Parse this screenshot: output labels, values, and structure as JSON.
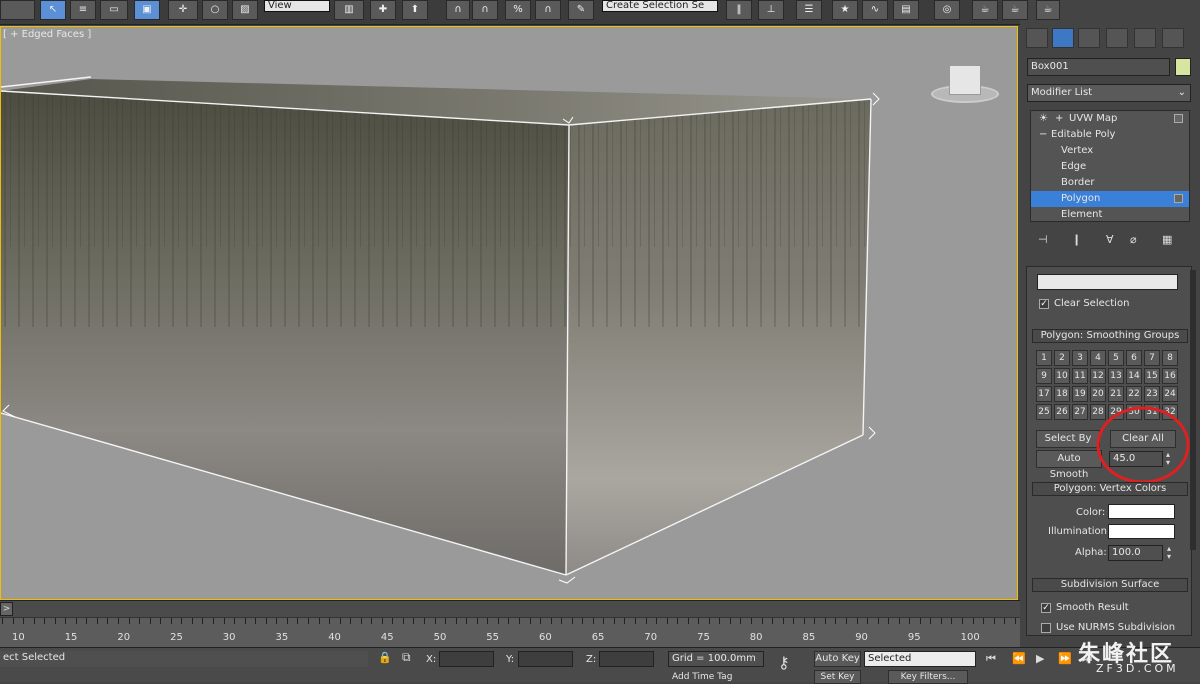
{
  "toolbar": {
    "view_dropdown": "View",
    "selection_set_dropdown": "Create Selection Se"
  },
  "viewport": {
    "label": "[ + Edged Faces ]"
  },
  "command_panel": {
    "object_name": "Box001",
    "modifier_list": "Modifier List",
    "stack": [
      {
        "label": "UVW Map"
      },
      {
        "label": "Editable Poly"
      },
      {
        "label": "Vertex"
      },
      {
        "label": "Edge"
      },
      {
        "label": "Border"
      },
      {
        "label": "Polygon"
      },
      {
        "label": "Element"
      }
    ],
    "clear_selection": "Clear Selection",
    "smoothing_groups": {
      "title": "Polygon: Smoothing Groups",
      "numbers": [
        "1",
        "2",
        "3",
        "4",
        "5",
        "6",
        "7",
        "8",
        "9",
        "10",
        "11",
        "12",
        "13",
        "14",
        "15",
        "16",
        "17",
        "18",
        "19",
        "20",
        "21",
        "22",
        "23",
        "24",
        "25",
        "26",
        "27",
        "28",
        "29",
        "30",
        "31",
        "32"
      ],
      "select_by_sg": "Select By SG",
      "clear_all": "Clear All",
      "auto_smooth": "Auto Smooth",
      "auto_smooth_value": "45.0"
    },
    "vertex_colors": {
      "title": "Polygon: Vertex Colors",
      "color_label": "Color:",
      "illumination_label": "Illumination:",
      "alpha_label": "Alpha:",
      "alpha_value": "100.0"
    },
    "subdivision": {
      "title": "Subdivision Surface",
      "smooth_result": "Smooth Result",
      "use_nurms": "Use NURMS Subdivision"
    }
  },
  "timeline": {
    "slider_button": ">",
    "ticks": [
      "10",
      "15",
      "20",
      "25",
      "30",
      "35",
      "40",
      "45",
      "50",
      "55",
      "60",
      "65",
      "70",
      "75",
      "80",
      "85",
      "90",
      "95",
      "100"
    ]
  },
  "status_bar": {
    "selection_text": "ect Selected",
    "x_label": "X:",
    "y_label": "Y:",
    "z_label": "Z:",
    "grid": "Grid = 100.0mm",
    "auto_key": "Auto Key",
    "selected": "Selected",
    "set_key": "Set Key",
    "key_filters": "Key Filters...",
    "add_time_tag": "Add Time Tag"
  },
  "watermark": {
    "text": "朱峰社区",
    "url": "ZF3D.COM"
  },
  "colors": {
    "accent": "#3a7fd8",
    "highlight_circle": "#e02020",
    "viewport_border": "#f0c000"
  }
}
